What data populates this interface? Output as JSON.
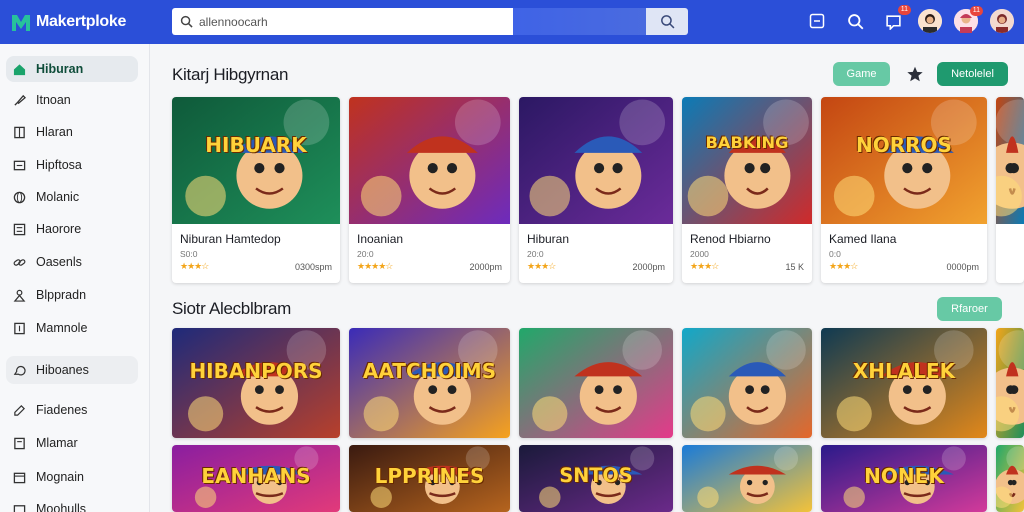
{
  "app": {
    "name": "Makertploke"
  },
  "search": {
    "value": "allennoocarh"
  },
  "top_icons": [
    {
      "icon": "inbox-icon"
    },
    {
      "icon": "search-icon"
    },
    {
      "icon": "notification-icon",
      "badge": "11"
    },
    {
      "icon": "user-avatar",
      "badge": ""
    },
    {
      "icon": "user-avatar-2",
      "badge": "11"
    },
    {
      "icon": "profile-avatar"
    }
  ],
  "sidebar": {
    "items": [
      {
        "label": "Hiburan",
        "icon": "home-icon"
      },
      {
        "label": "Itnoan",
        "icon": "brush-icon"
      },
      {
        "label": "Hlaran",
        "icon": "book-icon"
      },
      {
        "label": "Hipftosa",
        "icon": "card-icon"
      },
      {
        "label": "Molanic",
        "icon": "globe-icon"
      },
      {
        "label": "Haorore",
        "icon": "list-icon"
      },
      {
        "label": "Oasenls",
        "icon": "link-icon"
      },
      {
        "label": "Blppradn",
        "icon": "person-icon"
      },
      {
        "label": "Mamnole",
        "icon": "square-icon"
      },
      {
        "label": "Hiboanes",
        "icon": "chat-icon"
      },
      {
        "label": "Fiadenes",
        "icon": "edit-icon"
      },
      {
        "label": "Mlamar",
        "icon": "note-icon"
      },
      {
        "label": "Mognain",
        "icon": "calendar-icon"
      },
      {
        "label": "Moohulls",
        "icon": "box-icon"
      }
    ]
  },
  "section1": {
    "title": "Kitarj Hibgyrnan",
    "btn_game": "Game",
    "btn_other": "Netolelel",
    "cards": [
      {
        "title": "Niburan Hamtedop",
        "sub": "S0:0",
        "stars": "★★★☆",
        "price": "0300spm",
        "art": "HIBUARK",
        "c1": "#0f5a3a",
        "c2": "#1e8f5a"
      },
      {
        "title": "Inoanian",
        "sub": "20:0",
        "stars": "★★★★☆",
        "price": "2000pm",
        "art": "",
        "c1": "#c0321e",
        "c2": "#6d2bbd"
      },
      {
        "title": "Hiburan",
        "sub": "20:0",
        "stars": "★★★☆",
        "price": "2000pm",
        "art": "",
        "c1": "#2b1863",
        "c2": "#6b2b9a"
      },
      {
        "title": "Renod Hbiarno",
        "sub": "2000",
        "stars": "★★★☆",
        "price": "15 K",
        "art": "BABKING",
        "c1": "#0b7bb6",
        "c2": "#d02a2a"
      },
      {
        "title": "Kamed Ilana",
        "sub": "0:0",
        "stars": "★★★☆",
        "price": "0000pm",
        "art": "NORROS",
        "c1": "#c44612",
        "c2": "#f1a22f"
      }
    ]
  },
  "section2": {
    "title": "Siotr Alecblbram",
    "btn": "Rfaroer",
    "cards": [
      {
        "art": "HIBANPORS",
        "c1": "#1e2a7a",
        "c2": "#b8402b"
      },
      {
        "art": "AATCHOIMS",
        "c1": "#3a2bb8",
        "c2": "#f6a21e"
      },
      {
        "art": "",
        "c1": "#21a86a",
        "c2": "#e43a8a"
      },
      {
        "art": "",
        "c1": "#11a8c9",
        "c2": "#e5672a"
      },
      {
        "art": "XHLALEK",
        "c1": "#0f3a52",
        "c2": "#e2881a"
      }
    ],
    "row3": [
      {
        "art": "EANHANS",
        "c1": "#8a1ea0",
        "c2": "#e23a7a"
      },
      {
        "art": "LPPRINES",
        "c1": "#3a1a10",
        "c2": "#b5641e"
      },
      {
        "art": "SNTOS",
        "c1": "#1a1a3a",
        "c2": "#6b2a8a"
      },
      {
        "art": "",
        "c1": "#1a7bd8",
        "c2": "#f3c23a"
      },
      {
        "art": "NONEK",
        "c1": "#2a1a8a",
        "c2": "#d33a9a"
      }
    ]
  }
}
